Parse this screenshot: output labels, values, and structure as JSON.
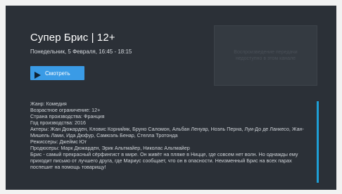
{
  "program": {
    "title": "Супер Брис | 12+",
    "datetime": "Понедельник, 5 Февраля, 16:45 - 18:15",
    "watch_label": "Смотреть",
    "poster_placeholder": "Воспроизведение передачи недоступно в этом канале"
  },
  "details": {
    "genre": "Жанр: Комедия",
    "age": "Возрастное ограничение: 12+",
    "country": "Страна производства: Франция",
    "year": "Год производства: 2016",
    "actors": "Актеры: Жан Дюжарден, Кловис Корнийяк, Бруно Саломон, Альбан Ленуар, Ноэль Перна, Луи-До де Ланкесо, Жан-Мишель Лами, Ида Дюфур, Самюэль Бенар, Стелла Тротонда",
    "directors": "Режиссеры: Джеймс Ют",
    "producers": "Продюсеры: Марк Дюжарден, Эрик Альтмайер, Николас Альтмайер",
    "description": "Брис - самый прекрасный сёрфингист в мире. Он живёт на пляже в Ницце, где совсем нет волн. Но однажды ему приходит письмо от лучшего друга, где Мариус сообщает, что он в опасности. Неизменный Брис на всех парах поспешит на помощь товарищу!"
  },
  "colors": {
    "background": "#2b3037",
    "accent": "#3a9be6",
    "scrollbar": "#1e9fd6"
  },
  "icons": {
    "watch": "play-icon"
  }
}
